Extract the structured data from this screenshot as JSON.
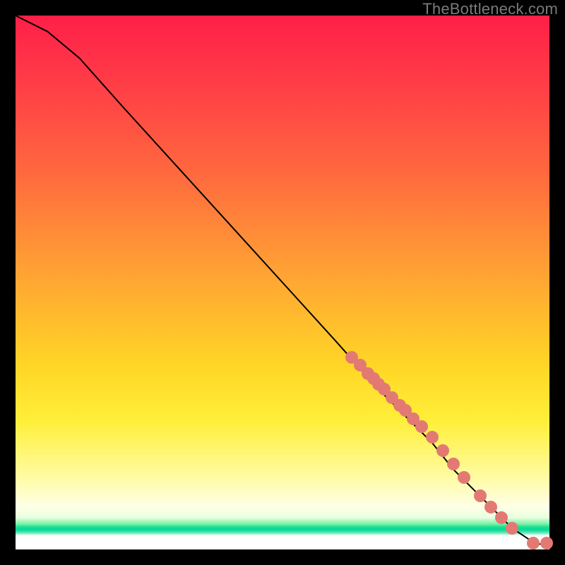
{
  "watermark": "TheBottleneck.com",
  "chart_data": {
    "type": "line",
    "title": "",
    "xlabel": "",
    "ylabel": "",
    "xlim": [
      0,
      100
    ],
    "ylim": [
      0,
      100
    ],
    "grid": false,
    "curve": {
      "x": [
        0,
        6,
        12,
        20,
        30,
        40,
        50,
        60,
        68,
        73,
        78,
        82,
        86,
        90,
        93,
        96,
        98,
        100
      ],
      "y": [
        100,
        97,
        92,
        83,
        72,
        61,
        50,
        39,
        30,
        25,
        20,
        15,
        11,
        7,
        4,
        2,
        1,
        1
      ]
    },
    "markers": {
      "x": [
        63,
        64.5,
        66,
        67,
        68,
        69,
        70.5,
        72,
        73,
        74.5,
        76,
        78,
        80,
        82,
        84,
        87,
        89,
        91,
        93,
        97,
        99.5
      ],
      "y": [
        36,
        34.5,
        33,
        32,
        31,
        30,
        28.5,
        27,
        26,
        24.5,
        23,
        21,
        18.5,
        16,
        13.5,
        10,
        8,
        6,
        4,
        1.2,
        1.2
      ]
    },
    "colors": {
      "line": "#000000",
      "marker": "#e27a73"
    }
  }
}
